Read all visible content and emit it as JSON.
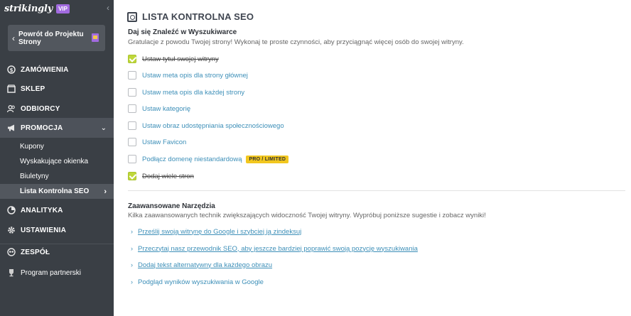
{
  "sidebar": {
    "brand": "strikingly",
    "vip_badge": "VIP",
    "back_button": "Powrót do Projektu Strony",
    "nav": [
      {
        "label": "ZAMÓWIENIA",
        "icon": "dollar-icon"
      },
      {
        "label": "SKLEP",
        "icon": "shop-icon"
      },
      {
        "label": "ODBIORCY",
        "icon": "users-icon"
      },
      {
        "label": "PROMOCJA",
        "icon": "megaphone-icon"
      },
      {
        "label": "ANALITYKA",
        "icon": "chart-icon"
      },
      {
        "label": "USTAWIENIA",
        "icon": "gear-icon"
      },
      {
        "label": "ZESPÓŁ",
        "icon": "team-icon"
      },
      {
        "label": "Program partnerski",
        "icon": "trophy-icon"
      }
    ],
    "promo_submenu": [
      "Kupony",
      "Wyskakujące okienka",
      "Biuletyny",
      "Lista Kontrolna SEO"
    ]
  },
  "main": {
    "title": "LISTA KONTROLNA SEO",
    "section1": {
      "heading": "Daj się Znaleźć w Wyszukiwarce",
      "subtitle": "Gratulacje z powodu Twojej strony! Wykonaj te proste czynności, aby przyciągnąć więcej osób do swojej witryny.",
      "items": [
        {
          "label": "Ustaw tytuł swojej witryny",
          "done": true
        },
        {
          "label": "Ustaw meta opis dla strony głównej",
          "done": false
        },
        {
          "label": "Ustaw meta opis dla każdej strony",
          "done": false
        },
        {
          "label": "Ustaw kategorię",
          "done": false
        },
        {
          "label": "Ustaw obraz udostępniania społecznościowego",
          "done": false
        },
        {
          "label": "Ustaw Favicon",
          "done": false
        },
        {
          "label": "Podłącz domenę niestandardową",
          "done": false,
          "badge": "PRO / LIMITED"
        },
        {
          "label": "Dodaj wiele stron",
          "done": true
        }
      ]
    },
    "section2": {
      "heading": "Zaawansowane Narzędzia",
      "subtitle": "Kilka zaawansowanych technik zwiększających widoczność Twojej witryny. Wypróbuj poniższe sugestie i zobacz wyniki!",
      "tools": [
        "Prześlij swoją witrynę do Google i szybciej ją zindeksuj",
        "Przeczytaj nasz przewodnik SEO, aby jeszcze bardziej poprawić swoją pozycję wyszukiwania",
        "Dodaj tekst alternatywny dla każdego obrazu",
        "Podgląd wyników wyszukiwania w Google"
      ]
    }
  },
  "colors": {
    "sidebar_bg": "#3a3f45",
    "link": "#3d8fb8",
    "check_done": "#bfd73a",
    "vip": "#a26be0",
    "pro_badge": "#f2c71f"
  }
}
